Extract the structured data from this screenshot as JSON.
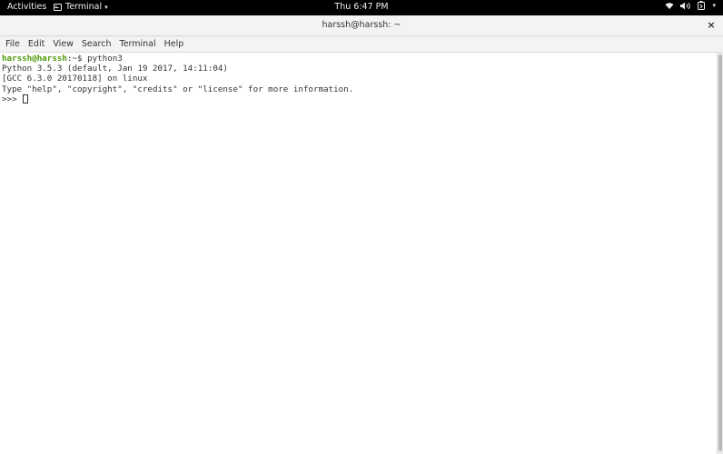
{
  "topbar": {
    "activities": "Activities",
    "app_menu": "Terminal",
    "app_menu_caret": "▾",
    "clock": "Thu  6:47 PM",
    "tray_icons": [
      "wifi-icon",
      "volume-icon",
      "battery-icon",
      "system-menu-caret"
    ]
  },
  "window": {
    "title": "harssh@harssh: ~",
    "close_label": "×"
  },
  "menubar": {
    "items": [
      "File",
      "Edit",
      "View",
      "Search",
      "Terminal",
      "Help"
    ]
  },
  "terminal": {
    "prompt_user": "harssh@harssh",
    "prompt_rest": ":~$ ",
    "command": "python3",
    "output": [
      "Python 3.5.3 (default, Jan 19 2017, 14:11:04)",
      "[GCC 6.3.0 20170118] on linux",
      "Type \"help\", \"copyright\", \"credits\" or \"license\" for more information."
    ],
    "repl_prompt": ">>> "
  },
  "colors": {
    "prompt_green": "#4e9a06",
    "text": "#2e3436",
    "topbar_bg": "#000000"
  }
}
